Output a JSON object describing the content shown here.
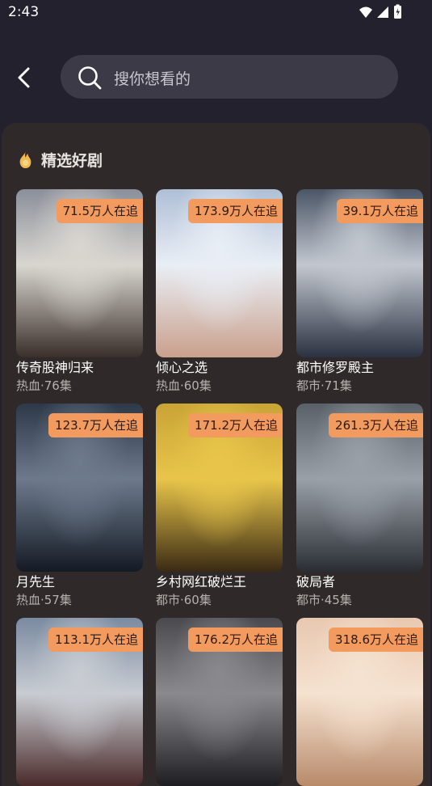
{
  "status": {
    "time": "2:43"
  },
  "search": {
    "placeholder": "搜你想看的"
  },
  "section": {
    "title": "精选好剧"
  },
  "dramas": [
    {
      "title": "传奇股神归来",
      "meta": "热血·76集",
      "badge": "71.5万人在追",
      "colors": [
        "#8a8f9a",
        "#d9d6d0",
        "#3a2f2a"
      ]
    },
    {
      "title": "倾心之选",
      "meta": "热血·60集",
      "badge": "173.9万人在追",
      "colors": [
        "#aebfd6",
        "#e9eef5",
        "#c9a08c"
      ]
    },
    {
      "title": "都市修罗殿主",
      "meta": "都市·71集",
      "badge": "39.1万人在追",
      "colors": [
        "#4a5566",
        "#c2c7cf",
        "#2a3140"
      ]
    },
    {
      "title": "月先生",
      "meta": "热血·57集",
      "badge": "123.7万人在追",
      "colors": [
        "#2d3848",
        "#6d7a8c",
        "#141a24"
      ]
    },
    {
      "title": "乡村网红破烂王",
      "meta": "都市·60集",
      "badge": "171.2万人在追",
      "colors": [
        "#c9a436",
        "#e8c54a",
        "#3a2a14"
      ]
    },
    {
      "title": "破局者",
      "meta": "都市·45集",
      "badge": "261.3万人在追",
      "colors": [
        "#5a6068",
        "#9aa0a8",
        "#2a2e34"
      ]
    },
    {
      "title": "",
      "meta": "",
      "badge": "113.1万人在追",
      "colors": [
        "#7a8aa0",
        "#c8ccd2",
        "#4a2a2a"
      ]
    },
    {
      "title": "",
      "meta": "",
      "badge": "176.2万人在追",
      "colors": [
        "#4a4a4e",
        "#8a8a8e",
        "#1e1e22"
      ]
    },
    {
      "title": "",
      "meta": "",
      "badge": "318.6万人在追",
      "colors": [
        "#e8c8b0",
        "#f5e2d0",
        "#b88a6a"
      ]
    }
  ]
}
